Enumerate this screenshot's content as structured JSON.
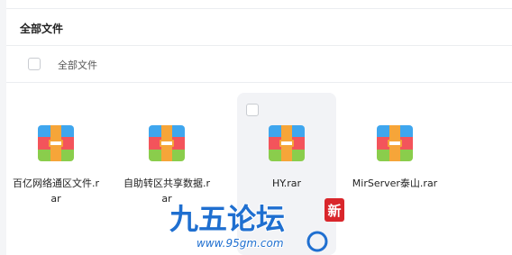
{
  "header": {
    "title": "全部文件"
  },
  "breadcrumb": {
    "label": "全部文件"
  },
  "files": [
    {
      "name": "百亿网络通区文件.rar"
    },
    {
      "name": "自助转区共享数据.rar"
    },
    {
      "name": "HY.rar"
    },
    {
      "name": "MirServer泰山.rar"
    }
  ],
  "watermark": {
    "logo_text": "九五论坛",
    "url": "www.95gm.com",
    "badge": "新"
  },
  "colors": {
    "rar_top": "#3fa6ee",
    "rar_mid": "#f3545b",
    "rar_bottom": "#8acd4c",
    "rar_strap": "#f6a539"
  }
}
